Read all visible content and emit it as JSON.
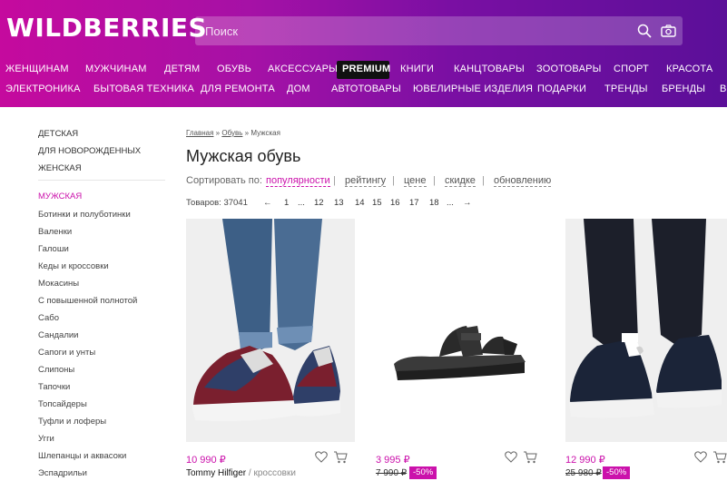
{
  "header": {
    "logo": "WILDBERRIES",
    "search_placeholder": "Поиск",
    "colors": {
      "gradient_start": "#c50a9e",
      "gradient_end": "#5b0f99",
      "accent": "#cb11ab"
    },
    "nav_row1": [
      "ЖЕНЩИНАМ",
      "МУЖЧИНАМ",
      "ДЕТЯМ",
      "ОБУВЬ",
      "АКСЕССУАРЫ",
      "PREMIUM",
      "КНИГИ",
      "КАНЦТОВАРЫ",
      "ЗООТОВАРЫ",
      "СПОРТ",
      "КРАСОТА"
    ],
    "nav_row2": [
      "ЭЛЕКТРОНИКА",
      "БЫТОВАЯ ТЕХНИКА",
      "ДЛЯ РЕМОНТА",
      "ДОМ",
      "АВТОТОВАРЫ",
      "ЮВЕЛИРНЫЕ ИЗДЕЛИЯ",
      "ПОДАРКИ",
      "ТРЕНДЫ",
      "БРЕНДЫ",
      "ВЕ"
    ]
  },
  "sidebar": {
    "top_items": [
      "ДЕТСКАЯ",
      "ДЛЯ НОВОРОЖДЕННЫХ",
      "ЖЕНСКАЯ"
    ],
    "active": "МУЖСКАЯ",
    "items": [
      "Ботинки и полуботинки",
      "Валенки",
      "Галоши",
      "Кеды и кроссовки",
      "Мокасины",
      "С повышенной полнотой",
      "Сабо",
      "Сандалии",
      "Сапоги и унты",
      "Слипоны",
      "Тапочки",
      "Топсайдеры",
      "Туфли и лоферы",
      "Угги",
      "Шлепанцы и аквасоки",
      "Эспадрильи"
    ]
  },
  "breadcrumbs": {
    "home": "Главная",
    "sep1": " » ",
    "shoes": "Обувь",
    "sep2": " » ",
    "current": "Мужская"
  },
  "page_title": "Мужская обувь",
  "sort": {
    "label": "Сортировать по:",
    "options": [
      "популярности",
      "рейтингу",
      "цене",
      "скидке",
      "обновлению"
    ],
    "separator": "|"
  },
  "pager": {
    "count_label": "Товаров: 37041",
    "prev": "←",
    "pages": [
      "1",
      "...",
      "12",
      "13",
      "14",
      "15",
      "16",
      "17",
      "18",
      "..."
    ],
    "next": "→"
  },
  "products": [
    {
      "price": "10 990 ₽",
      "brand": "Tommy Hilfiger",
      "brand_sep": " / ",
      "category": "кроссовки"
    },
    {
      "price": "3 995 ₽",
      "old_price": "7 990 ₽",
      "discount": "-50%"
    },
    {
      "price": "12 990 ₽",
      "old_price": "25 980 ₽",
      "discount": "-50%"
    }
  ]
}
